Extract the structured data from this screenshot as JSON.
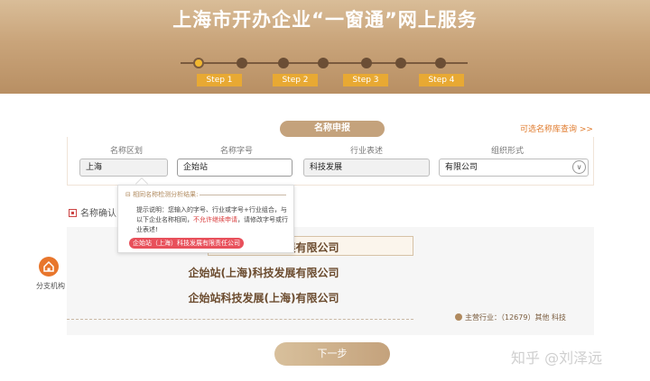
{
  "header": {
    "title": "上海市开办企业“一窗通”网上服务",
    "steps": [
      {
        "label": "Step 1",
        "active": true
      },
      {
        "label": "Step 2",
        "active": false
      },
      {
        "label": "Step 3",
        "active": false
      },
      {
        "label": "Step 4",
        "active": false
      }
    ]
  },
  "section_tab": "名称申报",
  "name_library_link": "可选名称库查询 >>",
  "form": {
    "columns": [
      {
        "label": "名称区划",
        "value": "上海"
      },
      {
        "label": "名称字号",
        "value": "企始站"
      },
      {
        "label": "行业表述",
        "value": "科技发展"
      },
      {
        "label": "组织形式",
        "value": "有限公司"
      }
    ]
  },
  "popup": {
    "title": "相同名称检测分析结果:",
    "text_before": "提示说明：您输入的字号、行业或字号+行业组合，与以下企业名称相同，",
    "text_warn": "不允许继续申请",
    "text_after": "，请修改字号或行业表述!",
    "match_tag": "企始站（上海）科技发展有限责任公司"
  },
  "confirm": {
    "heading": "名称确认",
    "candidates": [
      "企始站(上海)科技发展有限公司",
      "企始站(上海)科技发展有限公司",
      "企始站科技发展(上海)有限公司"
    ],
    "industry_note": "主营行业：（12679）其他 科技"
  },
  "branch": {
    "label": "分支机构"
  },
  "next_button": "下一步",
  "watermark": "知乎 @刘泽远",
  "colors": {
    "gold": "#c4a27c",
    "orange": "#e07b2d",
    "warn": "#d93a3a"
  }
}
